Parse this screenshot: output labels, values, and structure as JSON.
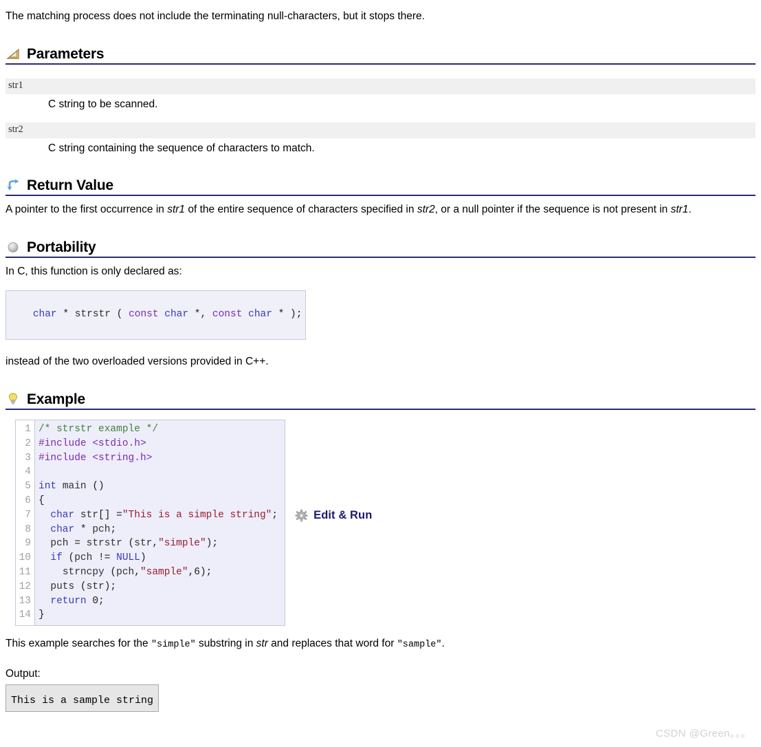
{
  "intro": {
    "text": "The matching process does not include the terminating null-characters, but it stops there."
  },
  "sections": {
    "parameters": {
      "title": "Parameters",
      "icon": "ruler-triangle-icon",
      "items": [
        {
          "name": "str1",
          "description": "C string to be scanned."
        },
        {
          "name": "str2",
          "description": "C string containing the sequence of characters to match."
        }
      ]
    },
    "return_value": {
      "title": "Return Value",
      "icon": "blue-return-arrow-icon",
      "text_part1": "A pointer to the first occurrence in ",
      "em1": "str1",
      "text_part2": " of the entire sequence of characters specified in ",
      "em2": "str2",
      "text_part3": ", or a null pointer if the sequence is not present in ",
      "em3": "str1",
      "text_part4": "."
    },
    "portability": {
      "title": "Portability",
      "icon": "gray-sphere-icon",
      "lead": "In C, this function is only declared as:",
      "signature_tokens": [
        {
          "t": "char",
          "c": "kw"
        },
        {
          "t": " * ",
          "c": "plain"
        },
        {
          "t": "strstr",
          "c": "id"
        },
        {
          "t": " ( ",
          "c": "plain"
        },
        {
          "t": "const",
          "c": "kw2"
        },
        {
          "t": " ",
          "c": "plain"
        },
        {
          "t": "char",
          "c": "kw"
        },
        {
          "t": " *, ",
          "c": "plain"
        },
        {
          "t": "const",
          "c": "kw2"
        },
        {
          "t": " ",
          "c": "plain"
        },
        {
          "t": "char",
          "c": "kw"
        },
        {
          "t": " * );",
          "c": "plain"
        }
      ],
      "signature_plain": "char * strstr ( const char *, const char * );",
      "trailing": "instead of the two overloaded versions provided in C++."
    },
    "example": {
      "title": "Example",
      "icon": "lightbulb-icon",
      "line_numbers": [
        "1",
        "2",
        "3",
        "4",
        "5",
        "6",
        "7",
        "8",
        "9",
        "10",
        "11",
        "12",
        "13",
        "14"
      ],
      "code_lines": [
        [
          {
            "t": "/* strstr example */",
            "c": "com"
          }
        ],
        [
          {
            "t": "#include",
            "c": "pp"
          },
          {
            "t": " ",
            "c": "plain"
          },
          {
            "t": "<stdio.h>",
            "c": "pp"
          }
        ],
        [
          {
            "t": "#include",
            "c": "pp"
          },
          {
            "t": " ",
            "c": "plain"
          },
          {
            "t": "<string.h>",
            "c": "pp"
          }
        ],
        [
          {
            "t": "",
            "c": "plain"
          }
        ],
        [
          {
            "t": "int",
            "c": "kw"
          },
          {
            "t": " ",
            "c": "plain"
          },
          {
            "t": "main",
            "c": "id"
          },
          {
            "t": " ()",
            "c": "plain"
          }
        ],
        [
          {
            "t": "{",
            "c": "plain"
          }
        ],
        [
          {
            "t": "  ",
            "c": "plain"
          },
          {
            "t": "char",
            "c": "kw"
          },
          {
            "t": " ",
            "c": "plain"
          },
          {
            "t": "str",
            "c": "id"
          },
          {
            "t": "[] =",
            "c": "plain"
          },
          {
            "t": "\"This is a simple string\"",
            "c": "str"
          },
          {
            "t": ";",
            "c": "plain"
          }
        ],
        [
          {
            "t": "  ",
            "c": "plain"
          },
          {
            "t": "char",
            "c": "kw"
          },
          {
            "t": " * ",
            "c": "plain"
          },
          {
            "t": "pch",
            "c": "id"
          },
          {
            "t": ";",
            "c": "plain"
          }
        ],
        [
          {
            "t": "  ",
            "c": "plain"
          },
          {
            "t": "pch",
            "c": "id"
          },
          {
            "t": " = ",
            "c": "plain"
          },
          {
            "t": "strstr",
            "c": "id"
          },
          {
            "t": " (",
            "c": "plain"
          },
          {
            "t": "str",
            "c": "id"
          },
          {
            "t": ",",
            "c": "plain"
          },
          {
            "t": "\"simple\"",
            "c": "str"
          },
          {
            "t": ");",
            "c": "plain"
          }
        ],
        [
          {
            "t": "  ",
            "c": "plain"
          },
          {
            "t": "if",
            "c": "kw"
          },
          {
            "t": " (",
            "c": "plain"
          },
          {
            "t": "pch",
            "c": "id"
          },
          {
            "t": " != ",
            "c": "plain"
          },
          {
            "t": "NULL",
            "c": "kw"
          },
          {
            "t": ")",
            "c": "plain"
          }
        ],
        [
          {
            "t": "    ",
            "c": "plain"
          },
          {
            "t": "strncpy",
            "c": "id"
          },
          {
            "t": " (",
            "c": "plain"
          },
          {
            "t": "pch",
            "c": "id"
          },
          {
            "t": ",",
            "c": "plain"
          },
          {
            "t": "\"sample\"",
            "c": "str"
          },
          {
            "t": ",",
            "c": "plain"
          },
          {
            "t": "6",
            "c": "num"
          },
          {
            "t": ");",
            "c": "plain"
          }
        ],
        [
          {
            "t": "  ",
            "c": "plain"
          },
          {
            "t": "puts",
            "c": "id"
          },
          {
            "t": " (",
            "c": "plain"
          },
          {
            "t": "str",
            "c": "id"
          },
          {
            "t": ");",
            "c": "plain"
          }
        ],
        [
          {
            "t": "  ",
            "c": "plain"
          },
          {
            "t": "return",
            "c": "kw"
          },
          {
            "t": " ",
            "c": "plain"
          },
          {
            "t": "0",
            "c": "num"
          },
          {
            "t": ";",
            "c": "plain"
          }
        ],
        [
          {
            "t": "}",
            "c": "plain"
          }
        ]
      ],
      "edit_run_label": "Edit & Run",
      "edit_run_icon": "gear-icon",
      "explanation": {
        "part1": "This example searches for the ",
        "mono1": "\"simple\"",
        "part2": " substring in ",
        "em1": "str",
        "part3": " and replaces that word for ",
        "mono2": "\"sample\"",
        "part4": "."
      },
      "output_label": "Output:",
      "output_text": "This is a sample string"
    }
  },
  "watermark": {
    "text": "CSDN @Green。。。"
  },
  "colors": {
    "section_rule": "#2a2a7a",
    "param_band": "#f0f0f0",
    "code_bg": "#eeeefa",
    "code_border": "#c9c9d9",
    "output_bg": "#e6e6e6",
    "link": "#1b1b6e",
    "keyword": "#3838c0",
    "string": "#9a1c2e",
    "comment": "#3f7f3f",
    "preprocessor": "#7a2ab5"
  }
}
